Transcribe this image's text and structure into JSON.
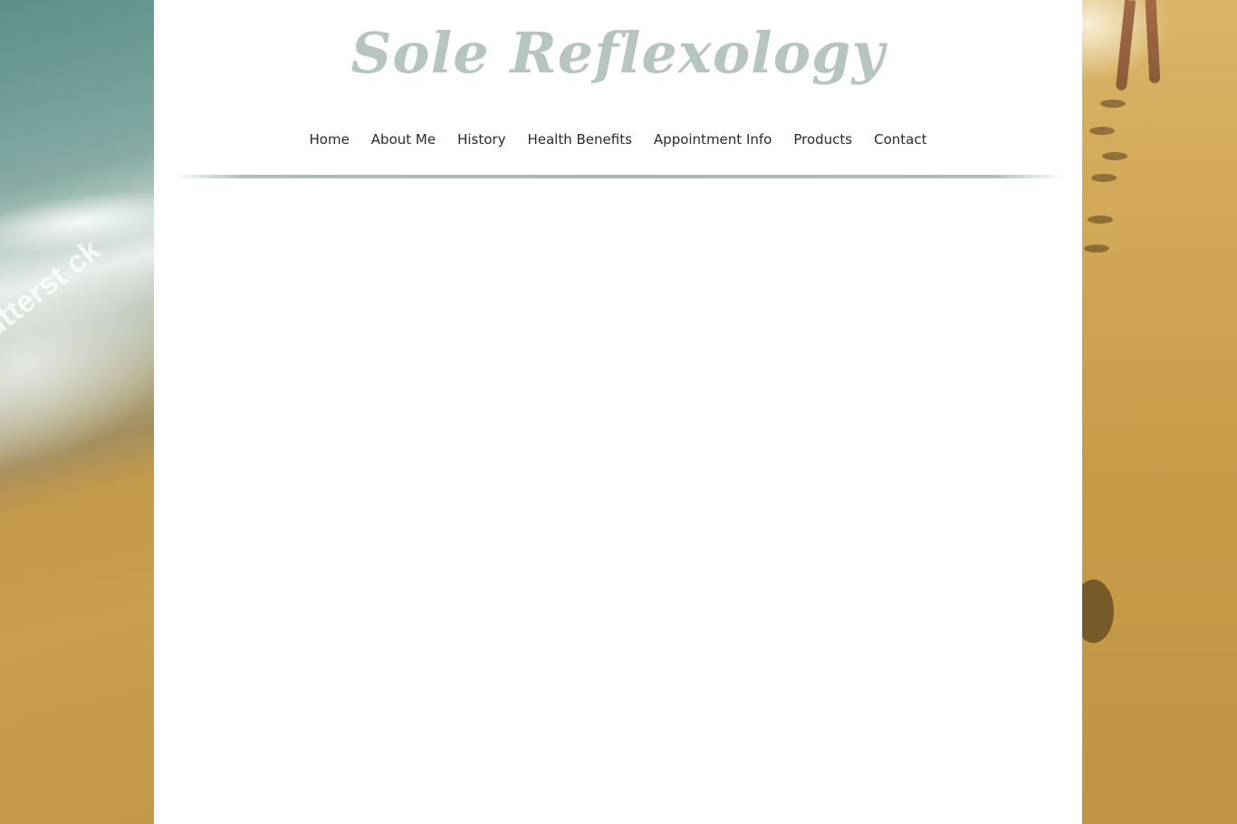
{
  "site": {
    "title": "Sole Reflexology"
  },
  "nav": {
    "items": [
      {
        "label": "Home"
      },
      {
        "label": "About Me"
      },
      {
        "label": "History"
      },
      {
        "label": "Health Benefits"
      },
      {
        "label": "Appointment Info"
      },
      {
        "label": "Products"
      },
      {
        "label": "Contact"
      }
    ]
  },
  "background": {
    "watermark_left": "utterst ck"
  },
  "colors": {
    "title": "#b7c5bf",
    "divider": "#a9b8b3",
    "nav_text": "#2a2a2a",
    "page_bg": "#ffffff",
    "sand": "#c9a24e"
  }
}
